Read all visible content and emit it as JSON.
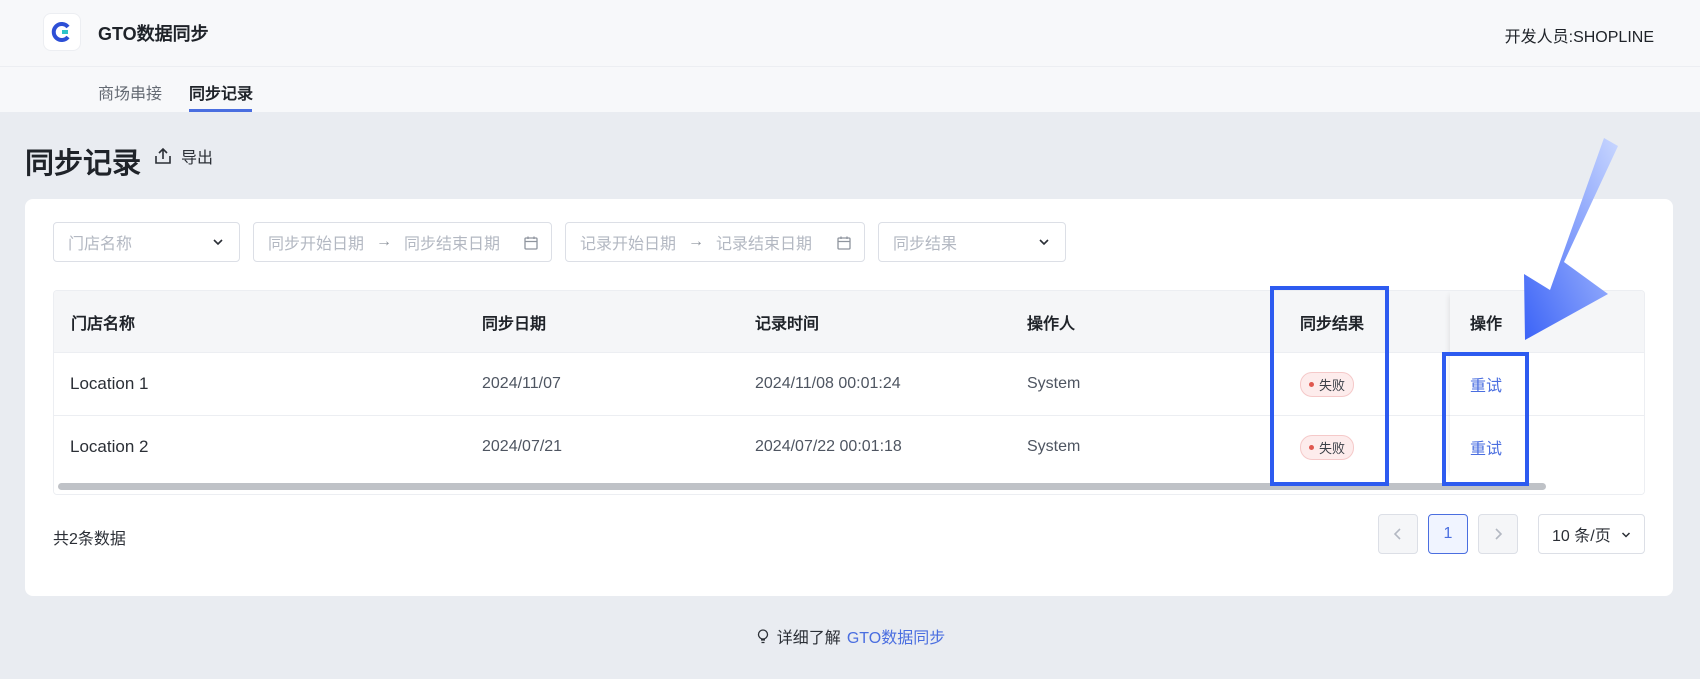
{
  "app": {
    "title": "GTO数据同步",
    "developer": "开发人员:SHOPLINE"
  },
  "tabs": [
    {
      "label": "商场串接",
      "active": false
    },
    {
      "label": "同步记录",
      "active": true
    }
  ],
  "page": {
    "title": "同步记录",
    "export_label": "导出"
  },
  "filters": {
    "store_placeholder": "门店名称",
    "sync_start_placeholder": "同步开始日期",
    "sync_end_placeholder": "同步结束日期",
    "record_start_placeholder": "记录开始日期",
    "record_end_placeholder": "记录结束日期",
    "result_placeholder": "同步结果"
  },
  "table": {
    "headers": [
      "门店名称",
      "同步日期",
      "记录时间",
      "操作人",
      "同步结果",
      "操作"
    ],
    "rows": [
      {
        "store": "Location 1",
        "sync_date": "2024/11/07",
        "record_time": "2024/11/08 00:01:24",
        "operator": "System",
        "result": "失败",
        "action": "重试"
      },
      {
        "store": "Location 2",
        "sync_date": "2024/07/21",
        "record_time": "2024/07/22 00:01:18",
        "operator": "System",
        "result": "失败",
        "action": "重试"
      }
    ]
  },
  "pagination": {
    "total": "共2条数据",
    "current_page": "1",
    "page_size": "10 条/页"
  },
  "footer": {
    "prefix": "详细了解",
    "link": "GTO数据同步"
  },
  "colors": {
    "accent": "#4a6ee0",
    "highlight": "#2d5bf0",
    "fail_badge_bg": "#fdecec",
    "fail_dot": "#e0584f"
  }
}
